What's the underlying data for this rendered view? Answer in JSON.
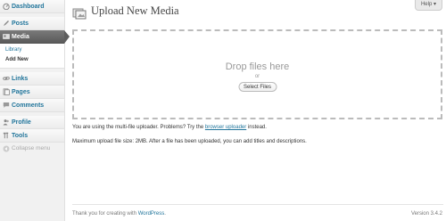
{
  "sidebar": {
    "items": [
      {
        "label": "Dashboard",
        "icon": "dashboard-icon"
      },
      {
        "label": "Posts",
        "icon": "posts-icon"
      },
      {
        "label": "Media",
        "icon": "media-icon",
        "current": true,
        "submenu": [
          {
            "label": "Library"
          },
          {
            "label": "Add New",
            "current": true
          }
        ]
      },
      {
        "label": "Links",
        "icon": "links-icon"
      },
      {
        "label": "Pages",
        "icon": "pages-icon"
      },
      {
        "label": "Comments",
        "icon": "comments-icon"
      },
      {
        "label": "Profile",
        "icon": "profile-icon"
      },
      {
        "label": "Tools",
        "icon": "tools-icon"
      }
    ],
    "collapse_label": "Collapse menu"
  },
  "header": {
    "help_label": "Help ▾",
    "title": "Upload New Media"
  },
  "uploader": {
    "drop_label": "Drop files here",
    "or_label": "or",
    "select_button": "Select Files"
  },
  "notices": {
    "multi_file_prefix": "You are using the multi-file uploader. Problems? Try the ",
    "browser_uploader_link": "browser uploader",
    "multi_file_suffix": " instead.",
    "max_size": "Maximum upload file size: 2MB. After a file has been uploaded, you can add titles and descriptions."
  },
  "footer": {
    "thanks_prefix": "Thank you for creating with ",
    "wordpress_link": "WordPress",
    "thanks_suffix": ".",
    "version": "Version 3.4.2"
  },
  "colors": {
    "link": "#21759b",
    "current_menu": "#5e5e5e",
    "sidebar_bg": "#f1f1f1"
  }
}
